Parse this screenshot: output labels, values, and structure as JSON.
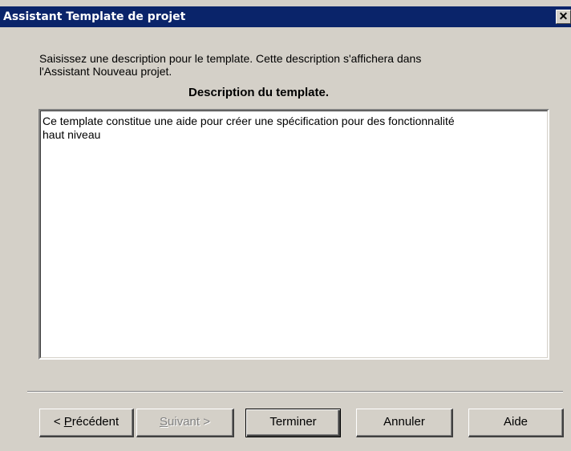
{
  "window": {
    "title": "Assistant Template de projet",
    "close_glyph": "✕"
  },
  "instructions": {
    "line1": "Saisissez une description pour le template. Cette description s'affichera dans",
    "line2": "l'Assistant Nouveau projet."
  },
  "description": {
    "heading": "Description du template.",
    "text": "Ce template constitue une aide pour créer une spécification pour des fonctionnalité\nhaut niveau"
  },
  "buttons": {
    "previous": {
      "prefix": "< ",
      "mnemonic": "P",
      "rest": "récédent"
    },
    "next": {
      "mnemonic": "S",
      "rest": "uivant >"
    },
    "finish": "Terminer",
    "cancel": "Annuler",
    "help": "Aide"
  },
  "colors": {
    "titlebar": "#0a246a",
    "dialog_bg": "#d4d0c8",
    "disabled_text": "#808080"
  }
}
